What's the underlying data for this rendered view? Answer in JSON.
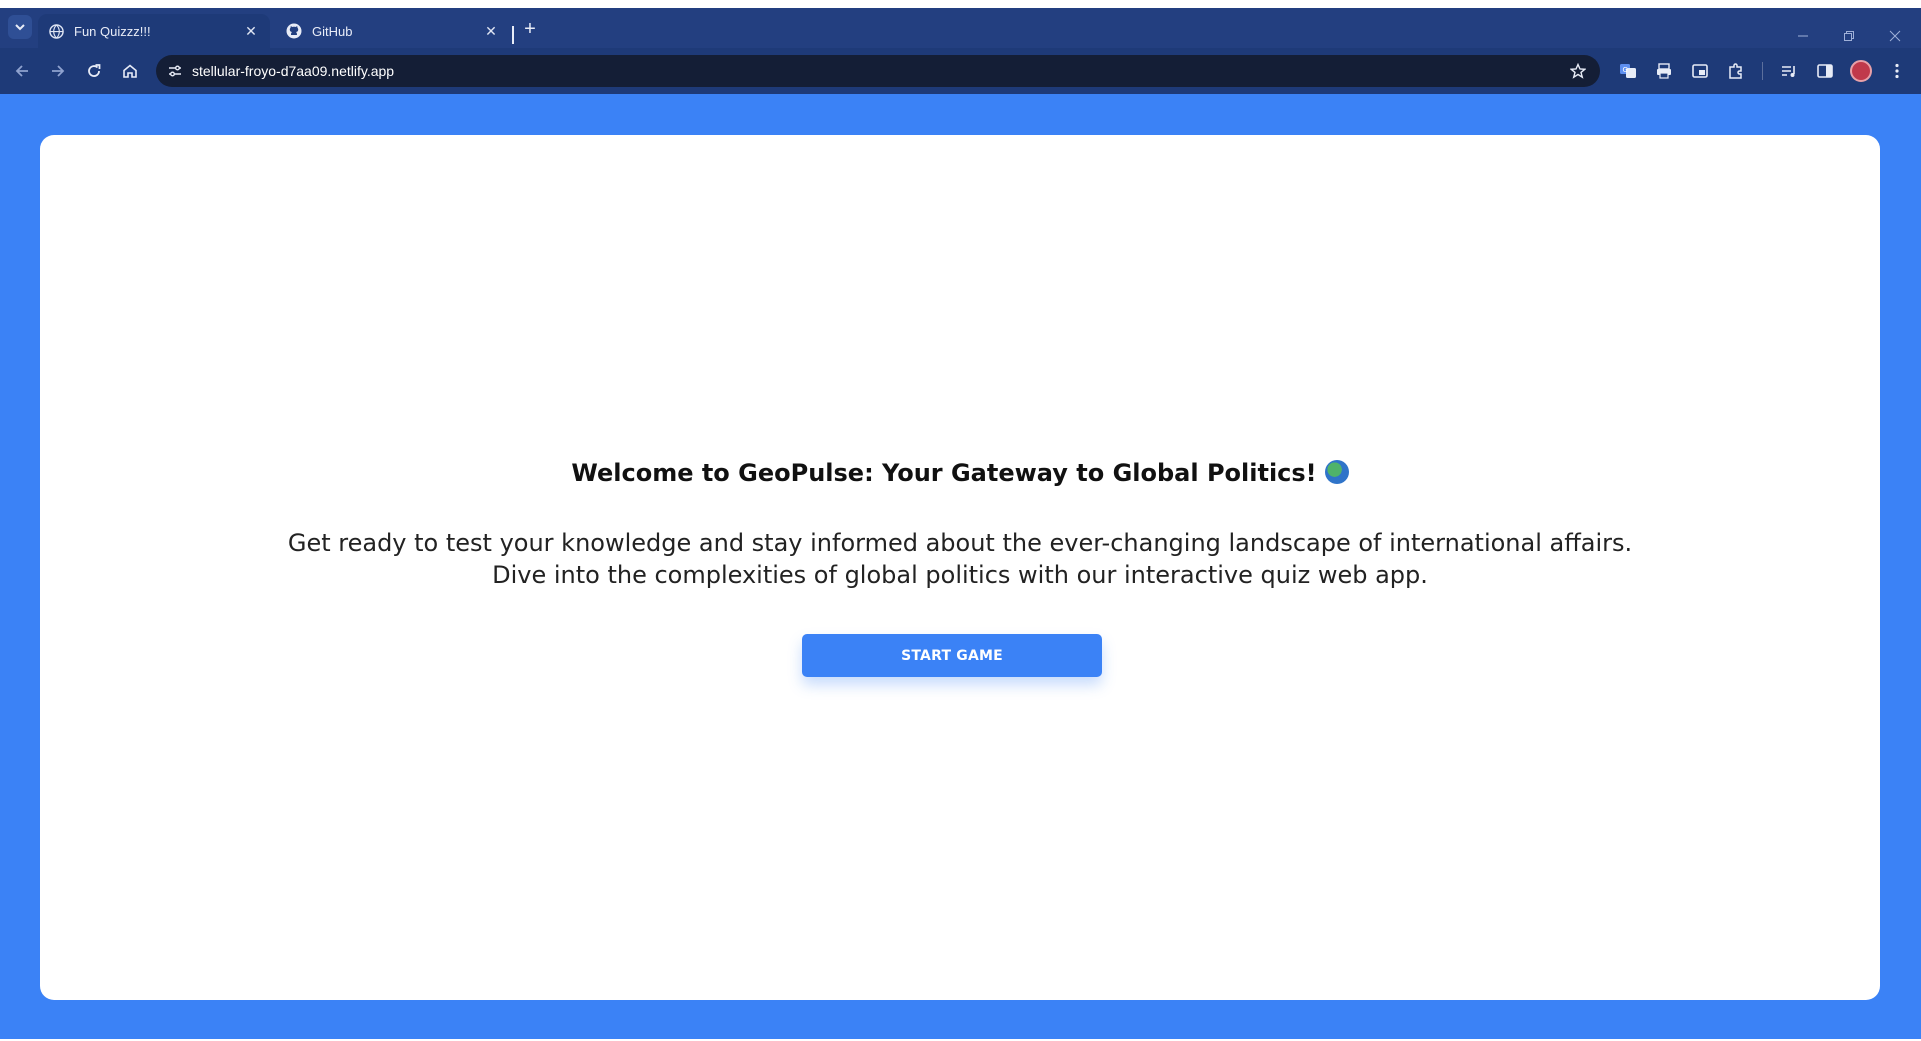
{
  "browser": {
    "tabs": [
      {
        "title": "Fun Quizzz!!!",
        "icon": "globe-icon",
        "active": true
      },
      {
        "title": "GitHub",
        "icon": "github-icon",
        "active": false
      }
    ],
    "address_bar": {
      "url": "stellular-froyo-d7aa09.netlify.app"
    }
  },
  "page": {
    "heading": "Welcome to GeoPulse: Your Gateway to Global Politics!",
    "intro": "Get ready to test your knowledge and stay informed about the ever-changing landscape of international affairs. Dive into the complexities of global politics with our interactive quiz web app.",
    "start_button": "START GAME"
  },
  "colors": {
    "accent": "#3b82f6",
    "tabbar": "#233f80",
    "toolbar": "#1e3a78"
  }
}
